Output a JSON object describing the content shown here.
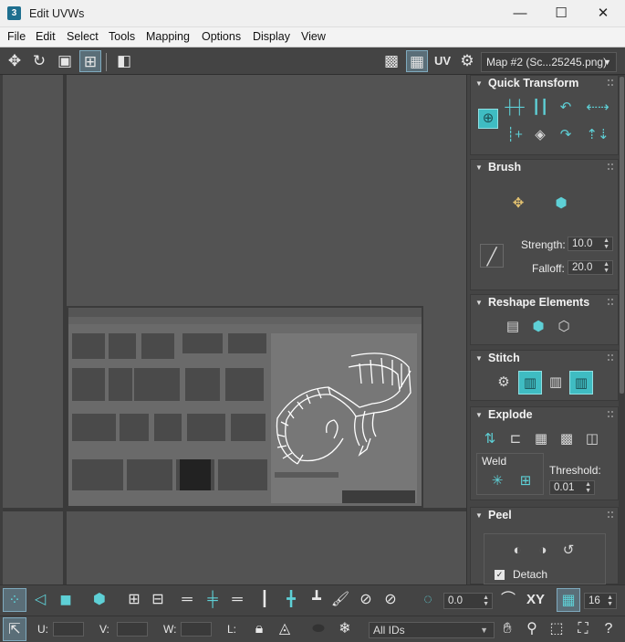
{
  "window": {
    "app_icon": "3",
    "title": "Edit UVWs",
    "minimize_icon": "—",
    "maximize_icon": "☐",
    "close_icon": "✕"
  },
  "menu": [
    "File",
    "Edit",
    "Select",
    "Tools",
    "Mapping",
    "Options",
    "Display",
    "View"
  ],
  "toolbar": {
    "uv_label": "UV",
    "map_select": "Map #2 (Sc...25245.png)"
  },
  "panel": {
    "quick_transform": {
      "title": "Quick Transform"
    },
    "brush": {
      "title": "Brush",
      "strength_label": "Strength:",
      "strength_value": "10.0",
      "falloff_label": "Falloff:",
      "falloff_value": "20.0"
    },
    "reshape": {
      "title": "Reshape Elements"
    },
    "stitch": {
      "title": "Stitch"
    },
    "explode": {
      "title": "Explode",
      "weld_label": "Weld",
      "threshold_label": "Threshold:",
      "threshold_value": "0.01"
    },
    "peel": {
      "title": "Peel",
      "detach_label": "Detach",
      "detach_checked": true
    }
  },
  "bottom": {
    "angle_value": "0.0",
    "xy_label": "XY",
    "grid_value": "16",
    "u_label": "U:",
    "v_label": "V:",
    "w_label": "W:",
    "l_label": "L:",
    "ids_select": "All IDs"
  },
  "colors": {
    "accent": "#3fbcc2",
    "background": "#444444",
    "viewport": "#535353"
  }
}
